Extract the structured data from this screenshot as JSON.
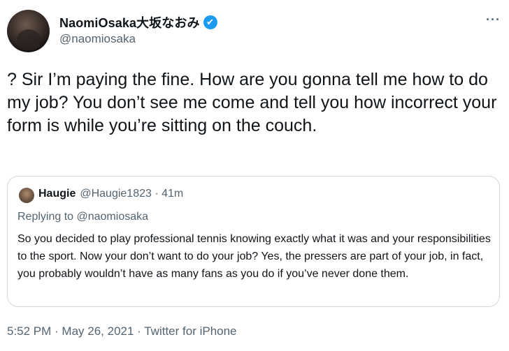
{
  "author": {
    "display_name": "NaomiOsaka大坂なおみ",
    "handle": "@naomiosaka",
    "verified_glyph": "✔",
    "more_glyph": "···"
  },
  "tweet": {
    "text": "? Sir I’m paying the fine. How are you gonna tell me how to do my job? You don’t see me come and tell you how incorrect your form is while you’re sitting on the couch."
  },
  "quoted": {
    "display_name": "Haugie",
    "meta": "@Haugie1823 · 41m",
    "replying_to": "Replying to @naomiosaka",
    "text": "So you decided to play professional tennis knowing exactly what it was and your responsibilities to the sport. Now your don’t want to do your job? Yes, the pressers are part of your job, in fact, you probably wouldn’t have as many fans as you do if you’ve never done them."
  },
  "footer": {
    "timestamp": "5:52 PM · May 26, 2021 · Twitter for iPhone"
  },
  "colors": {
    "verified": "#1d9bf0",
    "secondary_text": "#536471",
    "border": "#cfd9de"
  }
}
